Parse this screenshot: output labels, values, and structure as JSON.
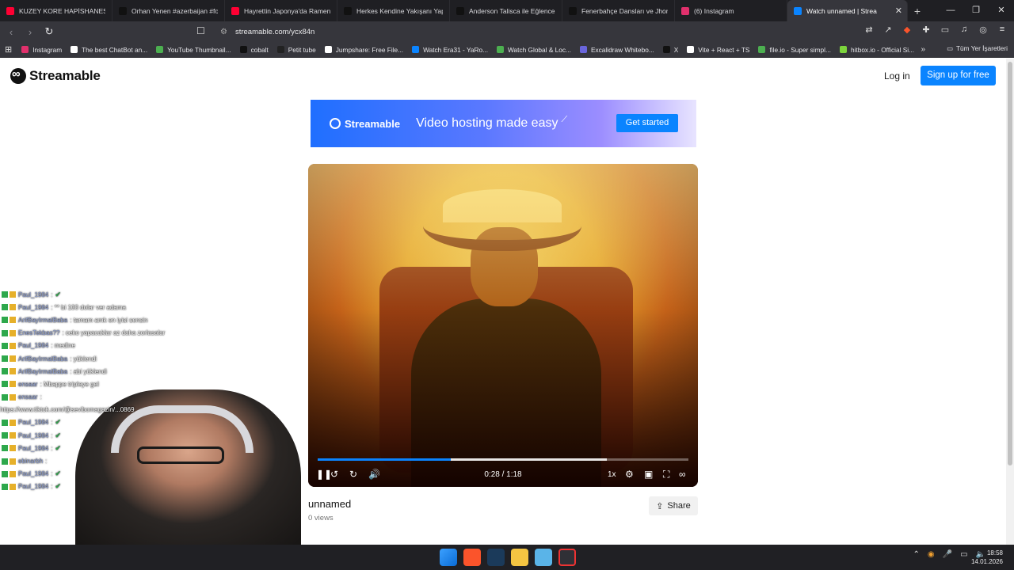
{
  "tabs": [
    {
      "label": "KUZEY KORE HAPİSHANESİNDE",
      "color": "#ff0033"
    },
    {
      "label": "Orhan Yenen #azerbaijan #for",
      "color": "#111111"
    },
    {
      "label": "Hayrettin Japonya'da Ramen Y",
      "color": "#ff0033"
    },
    {
      "label": "Herkes Kendine Yakışanı Yapıy",
      "color": "#111111"
    },
    {
      "label": "Anderson Talisca ile Eğlenceli D",
      "color": "#111111"
    },
    {
      "label": "Fenerbahçe Dansları ve Jhon D",
      "color": "#111111"
    },
    {
      "label": "(6) Instagram",
      "color": "#e1306c"
    },
    {
      "label": "Watch unnamed | Strea",
      "color": "#0a84ff"
    }
  ],
  "address": {
    "url": "streamable.com/ycx84n"
  },
  "bookmarks": [
    {
      "label": "Instagram",
      "color": "#e1306c"
    },
    {
      "label": "The best ChatBot an...",
      "color": "#ffffff"
    },
    {
      "label": "YouTube Thumbnail...",
      "color": "#4caf50"
    },
    {
      "label": "cobalt",
      "color": "#111111"
    },
    {
      "label": "Petit tube",
      "color": "#222222"
    },
    {
      "label": "Jumpshare: Free File...",
      "color": "#ffffff"
    },
    {
      "label": "Watch Era31 - YaRo...",
      "color": "#0a84ff"
    },
    {
      "label": "Watch Global & Loc...",
      "color": "#4caf50"
    },
    {
      "label": "Excalidraw Whitebo...",
      "color": "#6965db"
    },
    {
      "label": "X",
      "color": "#111111"
    },
    {
      "label": "Vite + React + TS",
      "color": "#ffffff"
    },
    {
      "label": "file.io - Super simpl...",
      "color": "#4caf50"
    },
    {
      "label": "hitbox.io - Official Si...",
      "color": "#7cd43c"
    }
  ],
  "bookmarks_folder": "Tüm Yer İşaretleri",
  "site": {
    "brand": "Streamable",
    "login": "Log in",
    "signup": "Sign up for free",
    "banner_brand": "Streamable",
    "banner_tagline": "Video hosting made easy",
    "banner_cta": "Get started"
  },
  "player": {
    "time": "0:28 / 1:18",
    "speed": "1x",
    "played_fraction": 0.36,
    "buffered_fraction": 0.78
  },
  "video": {
    "title": "unnamed",
    "views": "0 views",
    "share": "Share"
  },
  "chat": [
    {
      "user": "Paul_1984",
      "msg": ":",
      "check": true
    },
    {
      "user": "Paul_1984",
      "msg": ": ** bi 100 dolar ver adama",
      "check": false
    },
    {
      "user": "ArifBayIrmalBaba",
      "msg": ": tamam amk en iyisi sensin",
      "check": false
    },
    {
      "user": "EnesTekbas??",
      "msg": ": ceko yapacaklar az daha zorlasalar",
      "check": false
    },
    {
      "user": "Paul_1984",
      "msg": ": medine",
      "check": false
    },
    {
      "user": "ArifBayIrmalBaba",
      "msg": ": yüklendi",
      "check": false
    },
    {
      "user": "ArifBayIrmalBaba",
      "msg": ": abi yüklendi",
      "check": false
    },
    {
      "user": "ensaar",
      "msg": ": Mbappe tripleye gel",
      "check": false
    },
    {
      "user": "ensaar",
      "msg": ":",
      "check": false
    },
    {
      "user": "",
      "msg": "https://www.tiktok.com/@sevibomagazin/...0869",
      "check": false
    },
    {
      "user": "Paul_1984",
      "msg": ":",
      "check": true
    },
    {
      "user": "Paul_1984",
      "msg": ":",
      "check": true
    },
    {
      "user": "Paul_1984",
      "msg": ":",
      "check": true
    },
    {
      "user": "ebinarbh",
      "msg": ":",
      "check": false
    },
    {
      "user": "Paul_1984",
      "msg": ":",
      "check": true
    },
    {
      "user": "Paul_1984",
      "msg": ":",
      "check": true
    }
  ],
  "clock": {
    "time": "18:58",
    "date": "14.01.2026"
  }
}
